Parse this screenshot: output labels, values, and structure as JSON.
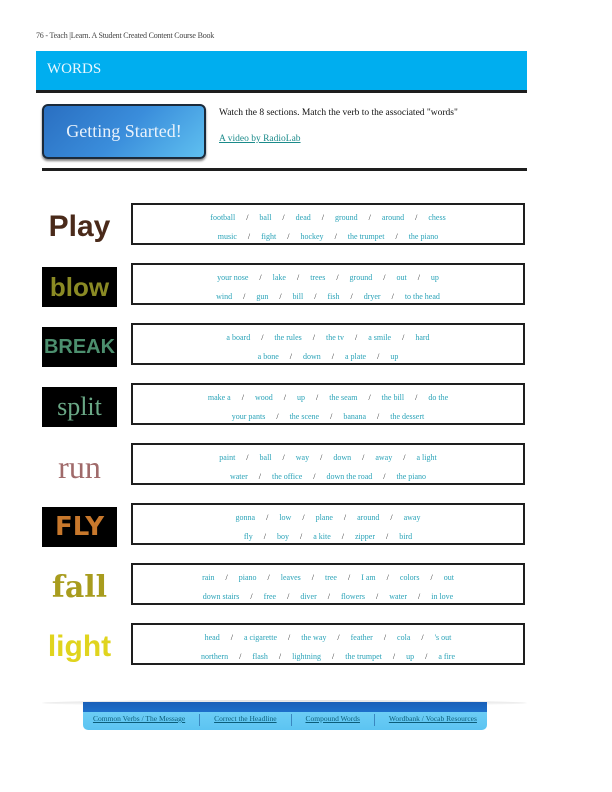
{
  "running_head": "76 - Teach |Learn. A Student Created Content Course Book",
  "header": {
    "title": "WORDS",
    "color": "#00aeef"
  },
  "intro": {
    "button_label": "Getting Started!",
    "instruction": "Watch the 8 sections. Match the verb to the associated \"words\"",
    "video_link": "A video by RadioLab"
  },
  "sections": [
    {
      "verb": "Play",
      "color": "#4a2a1a",
      "boxed": false,
      "row1": [
        "football",
        "ball",
        "dead",
        "ground",
        "around",
        "chess"
      ],
      "row2": [
        "music",
        "fight",
        "hockey",
        "the trumpet",
        "the piano"
      ]
    },
    {
      "verb": "blow",
      "color": "#8a8a24",
      "boxed": true,
      "row1": [
        "your nose",
        "lake",
        "trees",
        "ground",
        "out",
        "up"
      ],
      "row2": [
        "wind",
        "gun",
        "bill",
        "fish",
        "dryer",
        "to the head"
      ]
    },
    {
      "verb": "BREAK",
      "color": "#4c8f6e",
      "boxed": true,
      "row1": [
        "a board",
        "the rules",
        "the tv",
        "a smile",
        "hard"
      ],
      "row2": [
        "a bone",
        "down",
        "a plate",
        "up"
      ]
    },
    {
      "verb": "split",
      "color": "#6aa886",
      "boxed": true,
      "row1": [
        "make a",
        "wood",
        "up",
        "the seam",
        "the bill",
        "do the"
      ],
      "row2": [
        "your pants",
        "the scene",
        "banana",
        "the dessert"
      ]
    },
    {
      "verb": "run",
      "color": "#a06a6a",
      "boxed": false,
      "row1": [
        "paint",
        "ball",
        "way",
        "down",
        "away",
        "a light"
      ],
      "row2": [
        "water",
        "the office",
        "down the road",
        "the piano"
      ]
    },
    {
      "verb": "FLY",
      "color": "#c8782c",
      "boxed": true,
      "row1": [
        "gonna",
        "low",
        "plane",
        "around",
        "away"
      ],
      "row2": [
        "fly",
        "boy",
        "a kite",
        "zipper",
        "bird"
      ]
    },
    {
      "verb": "fall",
      "color": "#a89c1e",
      "boxed": false,
      "row1": [
        "rain",
        "piano",
        "leaves",
        "tree",
        "I am",
        "colors",
        "out"
      ],
      "row2": [
        "down stairs",
        "free",
        "diver",
        "flowers",
        "water",
        "in love"
      ]
    },
    {
      "verb": "light",
      "color": "#e0d41e",
      "boxed": false,
      "row1": [
        "head",
        "a cigarette",
        "the way",
        "feather",
        "cola",
        "'s out"
      ],
      "row2": [
        "northern",
        "flash",
        "lightning",
        "the trumpet",
        "up",
        "a fire"
      ]
    }
  ],
  "footer": {
    "links": [
      "Common Verbs / The Message",
      "Correct the Headline",
      "Compound Words",
      "Wordbank / Vocab Resources"
    ]
  }
}
